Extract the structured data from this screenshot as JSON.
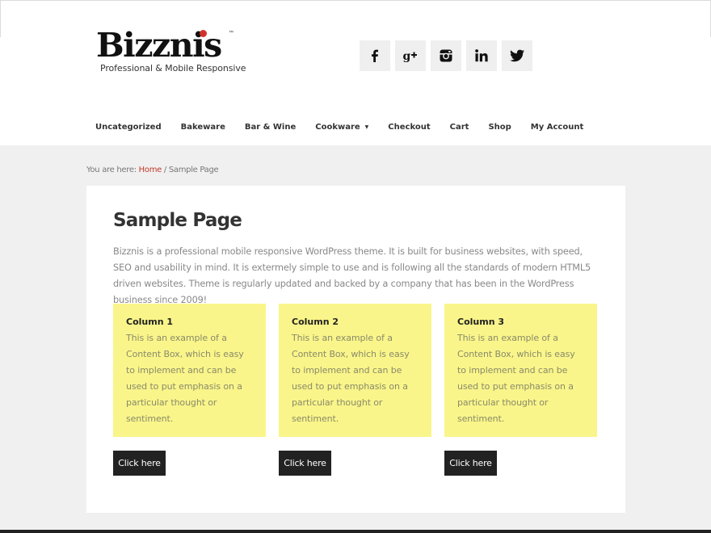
{
  "logo": {
    "name": "Bizznis",
    "tm": "™",
    "tagline": "Professional & Mobile Responsive"
  },
  "social": [
    "facebook-icon",
    "google-plus-icon",
    "instagram-icon",
    "linkedin-icon",
    "twitter-icon"
  ],
  "nav": {
    "items": [
      {
        "label": "Uncategorized"
      },
      {
        "label": "Bakeware"
      },
      {
        "label": "Bar & Wine"
      },
      {
        "label": "Cookware",
        "dropdown": "▼"
      },
      {
        "label": "Checkout"
      },
      {
        "label": "Cart"
      },
      {
        "label": "Shop"
      },
      {
        "label": "My Account"
      }
    ]
  },
  "breadcrumb": {
    "prefix": "You are here: ",
    "home": "Home",
    "separator": " / ",
    "current": "Sample Page"
  },
  "page": {
    "title": "Sample Page",
    "intro": "Bizznis is a professional mobile responsive WordPress theme. It is built for business websites, with speed, SEO and usability in mind. It is extermely simple to use and is following all the standards of modern HTML5 driven websites. Theme is regularly updated and backed by a company that has been in the WordPress business since 2009!"
  },
  "columns": [
    {
      "title": "Column 1",
      "text": "This is an example of a Content Box, which is easy to implement and can be used to put emphasis on a particular thought or sentiment.",
      "button": "Click here"
    },
    {
      "title": "Column 2",
      "text": "This is an example of a Content Box, which is easy to implement and can be used to put emphasis on a particular thought or sentiment.",
      "button": "Click here"
    },
    {
      "title": "Column 3",
      "text": "This is an example of a Content Box, which is easy to implement and can be used to put emphasis on a particular thought or sentiment.",
      "button": "Click here"
    }
  ],
  "colors": {
    "accent": "#c0392b",
    "box": "#f9f58a",
    "button": "#222222",
    "background": "#f0f0f0"
  }
}
